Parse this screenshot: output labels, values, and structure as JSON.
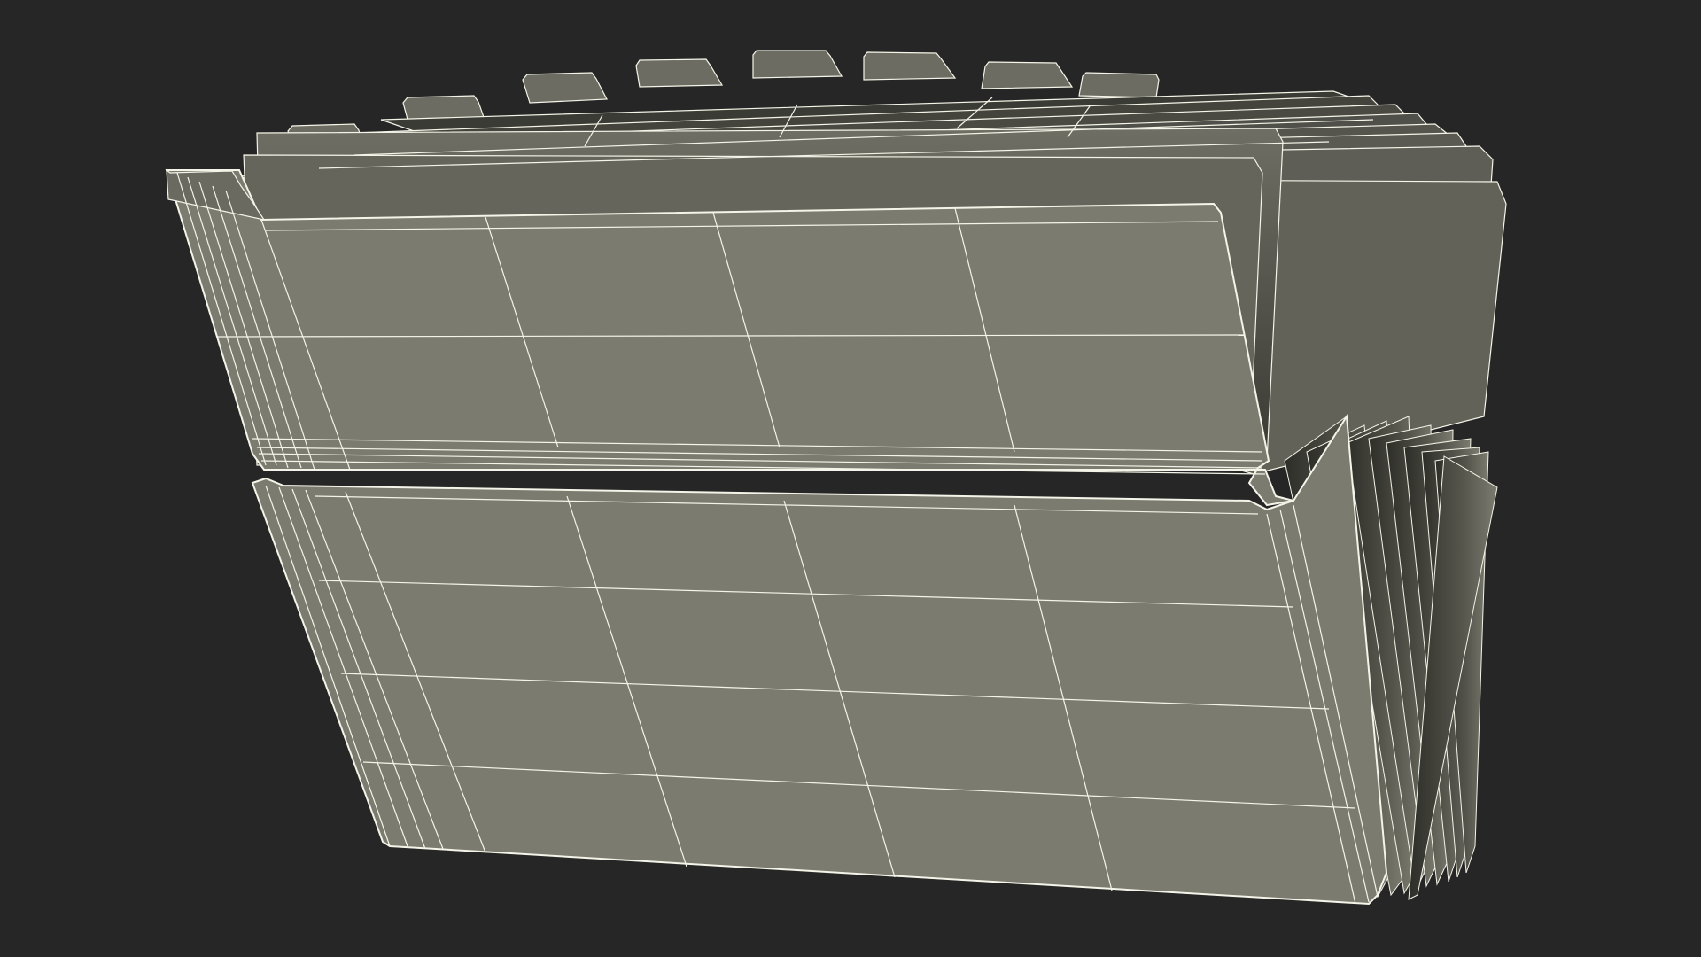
{
  "scene": {
    "subject": "expanding-file-folder-wireframe",
    "colors": {
      "background": "#262626",
      "surface": "#7b7b70",
      "surface_dark": "#5b5b52",
      "shadow": "#2f2f2a",
      "wire": "#f4f4e8"
    }
  }
}
